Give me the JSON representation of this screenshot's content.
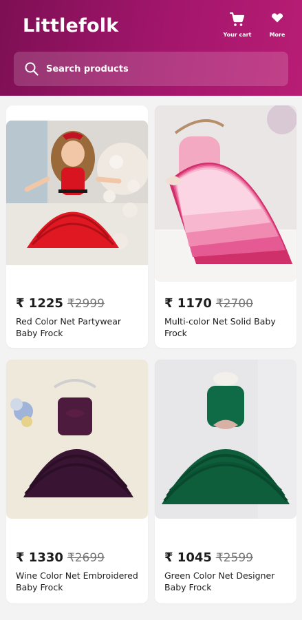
{
  "app": {
    "name": "Littlefolk"
  },
  "header": {
    "cart_label": "Your cart",
    "more_label": "More",
    "brand_color": "#a3166c"
  },
  "search": {
    "placeholder": "Search products"
  },
  "products": [
    {
      "price": "₹ 1225",
      "mrp": "₹2999",
      "title": "Red Color Net Partywear Baby Frock"
    },
    {
      "price": "₹ 1170",
      "mrp": "₹2700",
      "title": "Multi-color Net Solid Baby Frock"
    },
    {
      "price": "₹ 1330",
      "mrp": "₹2699",
      "title": "Wine Color Net Embroidered Baby Frock"
    },
    {
      "price": "₹ 1045",
      "mrp": "₹2599",
      "title": "Green Color Net Designer Baby Frock"
    }
  ]
}
